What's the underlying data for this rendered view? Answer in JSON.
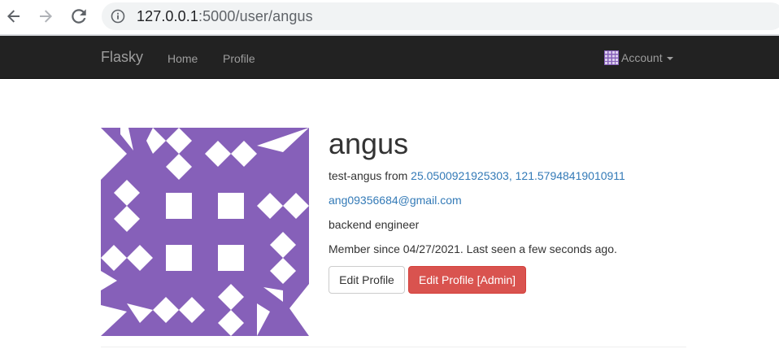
{
  "browser": {
    "url_host": "127.0.0.1",
    "url_path": ":5000/user/angus"
  },
  "navbar": {
    "brand": "Flasky",
    "links": [
      "Home",
      "Profile"
    ],
    "account_label": "Account"
  },
  "profile": {
    "username": "angus",
    "name": "test-angus",
    "from_label": "from",
    "location": "25.0500921925303, 121.57948419010911",
    "email": "ang09356684@gmail.com",
    "about": "backend engineer",
    "member_since": "Member since 04/27/2021. Last seen a few seconds ago.",
    "avatar_color": "#8660b9"
  },
  "buttons": {
    "edit_profile": "Edit Profile",
    "edit_profile_admin": "Edit Profile [Admin]"
  },
  "colors": {
    "navbar_bg": "#222222",
    "link": "#337ab7",
    "danger": "#d9534f"
  },
  "icons": [
    "back-arrow-icon",
    "forward-arrow-icon",
    "reload-icon",
    "info-icon",
    "caret-down-icon"
  ]
}
